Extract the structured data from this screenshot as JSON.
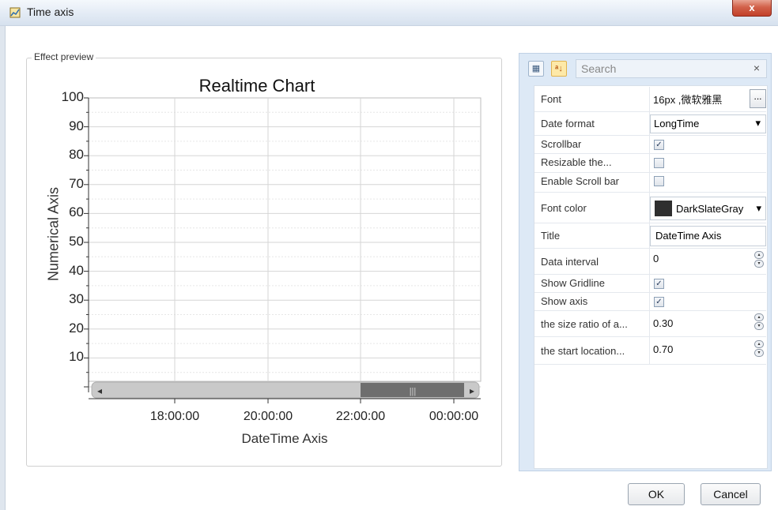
{
  "window": {
    "title": "Time axis",
    "close_glyph": "x"
  },
  "preview": {
    "legend": "Effect preview"
  },
  "chart_data": {
    "type": "line",
    "title": "Realtime Chart",
    "xlabel": "DateTime Axis",
    "ylabel": "Numerical Axis",
    "yticks": [
      "100",
      "90",
      "80",
      "70",
      "60",
      "50",
      "40",
      "30",
      "20",
      "10"
    ],
    "xticks": [
      "18:00:00",
      "20:00:00",
      "22:00:00",
      "00:00:00"
    ],
    "ylim": [
      0,
      100
    ],
    "grid": true,
    "series": [],
    "scrollbar": {
      "thumb_start": 0.7,
      "thumb_size": 0.3
    }
  },
  "properties_panel": {
    "toolbar": {
      "categorized_icon": "categorized-icon",
      "sort_icon": "sort-az-icon",
      "sort_label": "ᵃ↓"
    },
    "search": {
      "placeholder": "Search",
      "clear_glyph": "×"
    },
    "rows": [
      {
        "name": "Font",
        "value": "16px ,微软雅黑",
        "button": "..."
      },
      {
        "name": "Date format",
        "value": "LongTime"
      },
      {
        "name": "Scrollbar",
        "checked": true
      },
      {
        "name": "Resizable the...",
        "checked": false
      },
      {
        "name": "Enable Scroll bar",
        "checked": false
      },
      {
        "name": "Font color",
        "value": "DarkSlateGray",
        "color": "#2f2f2f"
      },
      {
        "name": "Title",
        "value": "DateTime Axis"
      },
      {
        "name": "Data interval",
        "value": "0"
      },
      {
        "name": "Show Gridline",
        "checked": true
      },
      {
        "name": "Show axis",
        "checked": true
      },
      {
        "name": "the size ratio of a...",
        "value": "0.30"
      },
      {
        "name": "the start location...",
        "value": "0.70"
      }
    ],
    "check_glyph": "✓",
    "dropdown_glyph": "▾",
    "spin_up": "▴",
    "spin_down": "▾"
  },
  "footer": {
    "ok_label": "OK",
    "cancel_label": "Cancel"
  },
  "scroll": {
    "left_arrow": "◂",
    "right_arrow": "▸",
    "grip": "|||"
  }
}
